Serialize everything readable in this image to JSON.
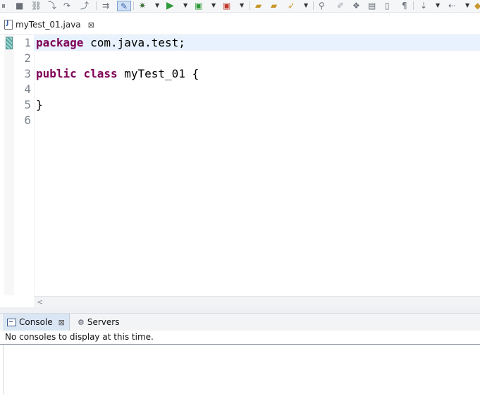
{
  "toolbar": {
    "icons": [
      "skip-all-breakpoints-icon",
      "terminate-icon",
      "disconnect-icon",
      "step-into-icon",
      "step-over-icon",
      "step-return-icon",
      "use-step-filters-icon",
      "toggle-mark-occurrences-icon",
      "debug-icon",
      "run-icon",
      "coverage-icon",
      "external-tools-icon",
      "new-java-package-icon",
      "new-java-class-icon",
      "open-type-icon",
      "search-icon",
      "toggle-breadcrumb-icon",
      "block-selection-icon",
      "show-whitespace-icon",
      "pilcrow-icon",
      "next-annotation-icon",
      "back-icon",
      "forward-icon"
    ]
  },
  "editor": {
    "tab_title": "myTest_01.java",
    "tab_close_glyph": "⊠",
    "line_numbers": [
      "1",
      "2",
      "3",
      "4",
      "5",
      "6"
    ],
    "lines": {
      "l1_kw": "package",
      "l1_rest": " com.java.test;",
      "l3_kw1": "public",
      "l3_kw2": "class",
      "l3_rest": " myTest_01 {",
      "l5": "}"
    },
    "scroll_left_glyph": "<"
  },
  "panel": {
    "console_tab": "Console",
    "console_close_glyph": "⊠",
    "servers_tab": "Servers",
    "message": "No consoles to display at this time."
  },
  "colors": {
    "keyword": "#7f0055",
    "current_line": "#e8f2fe",
    "line_number": "#7f868e"
  }
}
